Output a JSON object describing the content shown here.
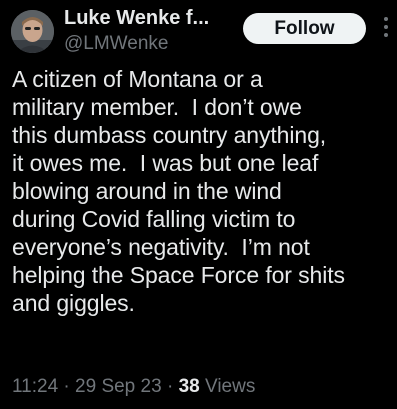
{
  "author": {
    "display_name": "Luke Wenke f...",
    "handle": "@LMWenke",
    "avatar_icon": "avatar-photo"
  },
  "actions": {
    "follow_label": "Follow",
    "more_icon": "more-vertical-icon"
  },
  "tweet": {
    "text": "A citizen of Montana or a\nmilitary member.  I don’t owe\nthis dumbass country anything,\nit owes me.  I was but one leaf\nblowing around in the wind\nduring Covid falling victim to\neveryone’s negativity.  I’m not\nhelping the Space Force for shits\nand giggles."
  },
  "meta": {
    "time": "11:24",
    "separator": " · ",
    "date": "29 Sep 23",
    "views_count": "38",
    "views_label": "Views"
  },
  "colors": {
    "background": "#000000",
    "primary_text": "#e7e9ea",
    "secondary_text": "#71767b",
    "button_bg": "#eff3f4",
    "button_text": "#0f1419"
  }
}
